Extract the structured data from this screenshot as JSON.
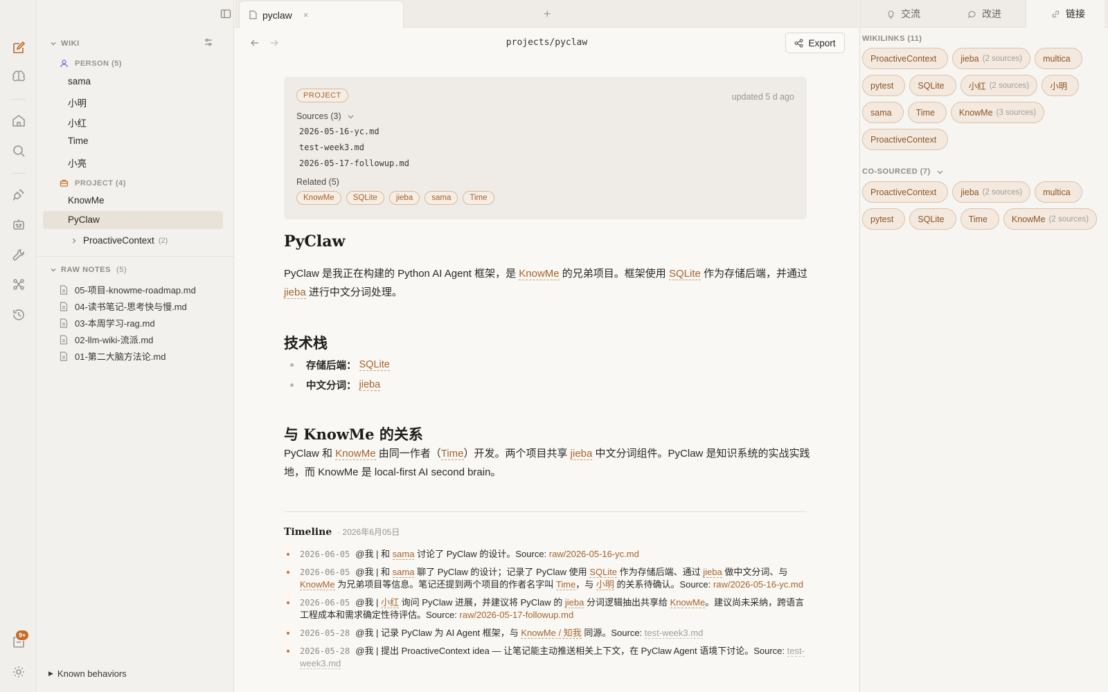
{
  "colors": {
    "accent": "#a8612a",
    "badge": "#c76a24",
    "chip_bg": "#f3e9de"
  },
  "rail": {
    "badge": "9+"
  },
  "sidebar": {
    "wiki_label": "WIKI",
    "person_label": "PERSON (5)",
    "persons": [
      "sama",
      "小明",
      "小红",
      "Time",
      "小亮"
    ],
    "project_label": "PROJECT (4)",
    "projects": [
      "KnowMe",
      "PyClaw"
    ],
    "sub_project": {
      "label": "ProactiveContext",
      "count": "(2)"
    },
    "raw_notes_label": "RAW NOTES",
    "raw_notes_count": "(5)",
    "raw_notes": [
      "05-项目-knowme-roadmap.md",
      "04-读书笔记-思考快与慢.md",
      "03-本周学习-rag.md",
      "02-llm-wiki-流派.md",
      "01-第二大脑方法论.md"
    ],
    "known_behaviors": "Known behaviors"
  },
  "tab": {
    "title": "pyclaw",
    "close": "×",
    "add": "+"
  },
  "toolbar": {
    "path": "projects/pyclaw",
    "export": "Export"
  },
  "meta": {
    "type_pill": "PROJECT",
    "updated": "updated 5 d ago",
    "sources_label": "Sources (3)",
    "sources": [
      "2026-05-16-yc.md",
      "test-week3.md",
      "2026-05-17-followup.md"
    ],
    "related_label": "Related (5)",
    "related": [
      "KnowMe",
      "SQLite",
      "jieba",
      "sama",
      "Time"
    ]
  },
  "doc": {
    "title": "PyClaw",
    "intro": {
      "p1": "PyClaw 是我正在构建的 Python AI Agent 框架，是 ",
      "l1": "KnowMe",
      "p2": " 的兄弟项目。框架使用 ",
      "l2": "SQLite",
      "p3": " 作为存储后端，并通过 ",
      "l3": "jieba",
      "p4": " 进行中文分词处理。"
    },
    "tech_heading": "技术栈",
    "tech": [
      {
        "k": "存储后端：",
        "v": "SQLite"
      },
      {
        "k": "中文分词：",
        "v": "jieba"
      }
    ],
    "rel_heading": "与 KnowMe 的关系",
    "rel": {
      "p1": "PyClaw 和 ",
      "l1": "KnowMe",
      "p2": " 由同一作者（",
      "l2": "Time",
      "p3": "）开发。两个项目共享 ",
      "l3": "jieba",
      "p4": " 中文分词组件。PyClaw 是知识系统的实战实践地，而 KnowMe 是 local-first AI second brain。"
    },
    "timeline_title": "Timeline",
    "timeline_date": "· 2026年6月05日",
    "timeline": [
      {
        "date": "2026-06-05",
        "a": "@我 | 和 ",
        "l1": "sama",
        "b": " 讨论了 PyClaw 的设计。Source: ",
        "src": "raw/2026-05-16-yc.md"
      },
      {
        "date": "2026-06-05",
        "a": "@我 | 和 ",
        "l1": "sama",
        "b": " 聊了 PyClaw 的设计；记录了 PyClaw 使用 ",
        "l2": "SQLite",
        "c": " 作为存储后端、通过 ",
        "l3": "jieba",
        "d": " 做中文分词、与 ",
        "l4": "KnowMe",
        "e": " 为兄弟项目等信息。笔记还提到两个项目的作者名字叫 ",
        "l5": "Time",
        "f": "，与 ",
        "l6": "小明",
        "g": " 的关系待确认。Source: ",
        "src": "raw/2026-05-16-yc.md"
      },
      {
        "date": "2026-06-05",
        "a": "@我 | ",
        "l1": "小红",
        "b": " 询问 PyClaw 进展，并建议将 PyClaw 的 ",
        "l2": "jieba",
        "c": " 分词逻辑抽出共享给 ",
        "l3": "KnowMe",
        "d": "。建议尚未采纳，跨语言工程成本和需求确定性待评估。Source: ",
        "src": "raw/2026-05-17-followup.md"
      },
      {
        "date": "2026-05-28",
        "a": "@我 | 记录 PyClaw 为 AI Agent 框架，与 ",
        "l1": "KnowMe / 知我",
        "b": " 同源。Source: ",
        "src": "test-week3.md"
      },
      {
        "date": "2026-05-28",
        "a": "@我 | 提出 ProactiveContext idea — 让笔记能主动推送相关上下文，在 PyClaw Agent 语境下讨论。Source: ",
        "src": "test-week3.md"
      }
    ]
  },
  "right": {
    "tabs": [
      "交流",
      "改进",
      "链接"
    ],
    "wikilinks_label": "WIKILINKS (11)",
    "wikilinks": [
      {
        "name": "ProactiveContext",
        "n": ""
      },
      {
        "name": "jieba",
        "n": "(2 sources)"
      },
      {
        "name": "multica",
        "n": ""
      },
      {
        "name": "pytest",
        "n": ""
      },
      {
        "name": "SQLite",
        "n": ""
      },
      {
        "name": "小红",
        "n": "(2 sources)"
      },
      {
        "name": "小明",
        "n": ""
      },
      {
        "name": "sama",
        "n": ""
      },
      {
        "name": "Time",
        "n": ""
      },
      {
        "name": "KnowMe",
        "n": "(3 sources)"
      },
      {
        "name": "ProactiveContext",
        "n": ""
      }
    ],
    "cosourced_label": "CO-SOURCED (7)",
    "cosourced": [
      {
        "name": "ProactiveContext",
        "n": ""
      },
      {
        "name": "jieba",
        "n": "(2 sources)"
      },
      {
        "name": "multica",
        "n": ""
      },
      {
        "name": "pytest",
        "n": ""
      },
      {
        "name": "SQLite",
        "n": ""
      },
      {
        "name": "Time",
        "n": ""
      },
      {
        "name": "KnowMe",
        "n": "(2 sources)"
      }
    ]
  }
}
